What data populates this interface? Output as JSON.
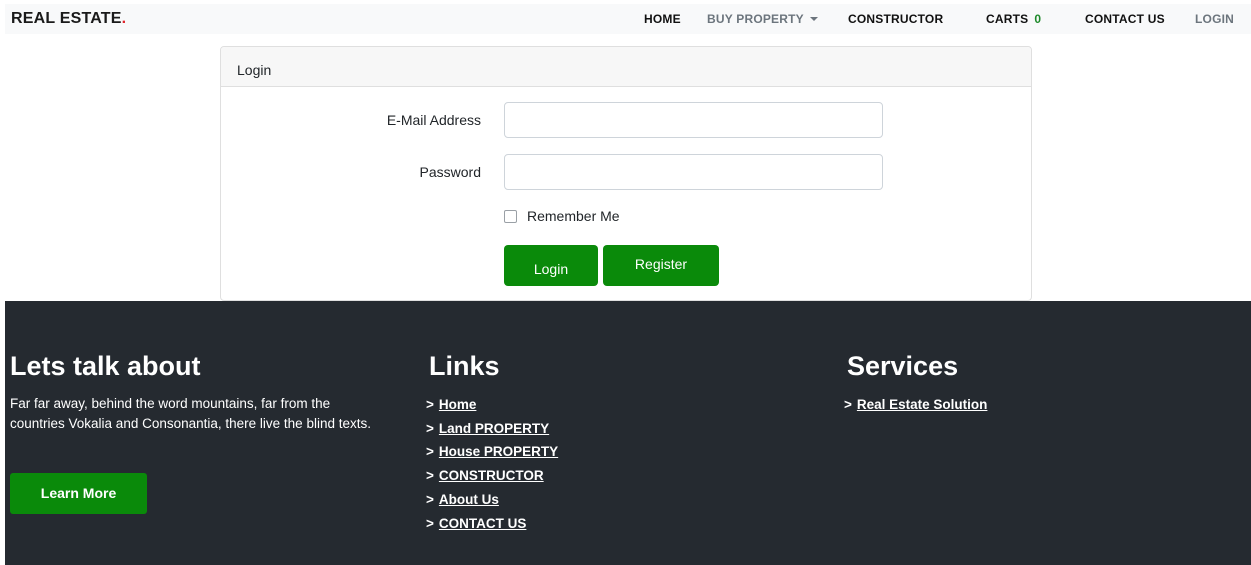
{
  "navbar": {
    "brand": "REAL ESTATE",
    "brand_dot": ".",
    "items": {
      "home": "HOME",
      "buy_property": "BUY PROPERTY",
      "constructor": "CONSTRUCTOR",
      "carts": "CARTS",
      "carts_count": "0",
      "contact_us": "CONTACT US",
      "login": "LOGIN"
    }
  },
  "login_card": {
    "header": "Login",
    "email_label": "E-Mail Address",
    "email_value": "",
    "password_label": "Password",
    "password_value": "",
    "remember_label": "Remember Me",
    "login_button": "Login",
    "register_button": "Register"
  },
  "footer": {
    "about": {
      "heading": "Lets talk about",
      "text": "Far far away, behind the word mountains, far from the countries Vokalia and Consonantia, there live the blind texts.",
      "button": "Learn More"
    },
    "links": {
      "heading": "Links",
      "items": [
        "Home",
        "Land PROPERTY",
        "House PROPERTY",
        "CONSTRUCTOR",
        "About Us",
        "CONTACT US"
      ]
    },
    "services": {
      "heading": "Services",
      "items": [
        "Real Estate Solution"
      ]
    },
    "arrow_glyph": ">"
  },
  "colors": {
    "accent_green": "#0a8a0a",
    "brand_red": "#e0242b",
    "footer_bg": "#252a30",
    "navbar_bg": "#f8f9fa"
  }
}
